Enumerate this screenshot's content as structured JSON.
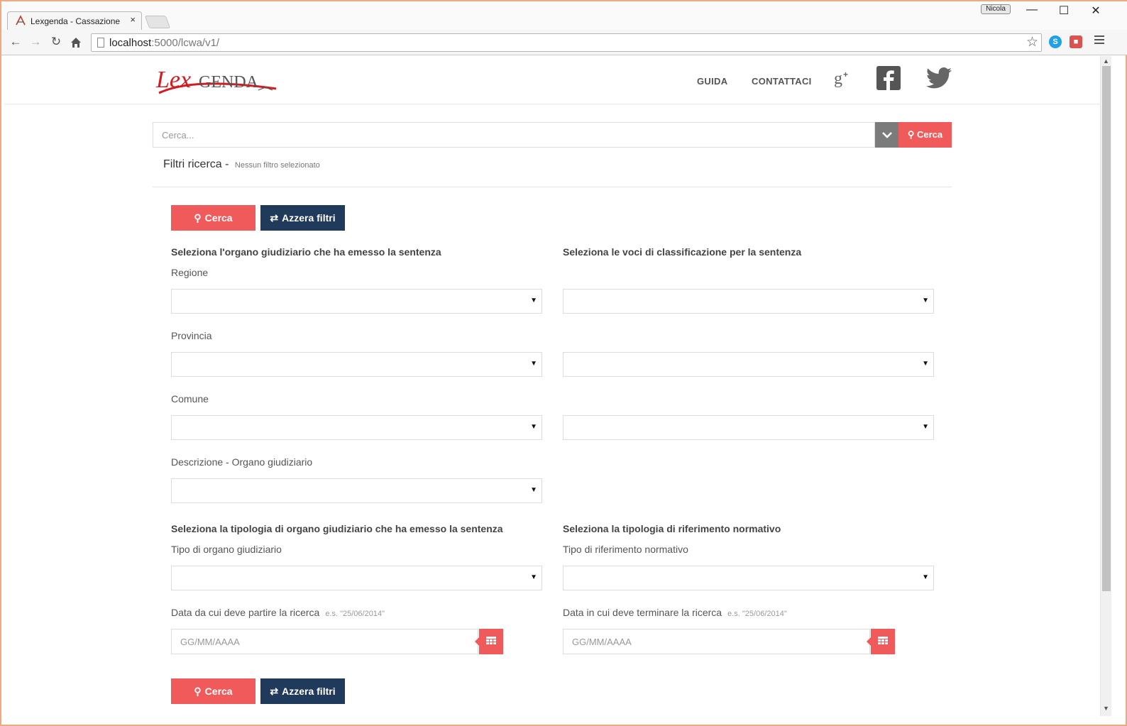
{
  "browser": {
    "tab_title": "Lexgenda - Cassazione",
    "tab_close": "×",
    "profile_name": "Nicola",
    "url_host": "localhost",
    "url_rest": ":5000/lcwa/v1/",
    "controls": {
      "minimize": "—",
      "maximize": "☐",
      "close": "✕"
    }
  },
  "header": {
    "logo_text": "LexGENDA",
    "nav": [
      {
        "label": "GUIDA"
      },
      {
        "label": "CONTATTACI"
      }
    ],
    "social": [
      "google-plus-icon",
      "facebook-icon",
      "twitter-icon"
    ]
  },
  "search": {
    "placeholder": "Cerca...",
    "button_label": "Cerca"
  },
  "filters": {
    "title": "Filtri ricerca",
    "separator": "-",
    "status": "Nessun filtro selezionato"
  },
  "actions": {
    "search_label": "Cerca",
    "reset_label": "Azzera filtri"
  },
  "organ_section": {
    "title": "Seleziona l'organo giudiziario che ha emesso la sentenza",
    "fields": [
      {
        "label": "Regione",
        "value": ""
      },
      {
        "label": "Provincia",
        "value": ""
      },
      {
        "label": "Comune",
        "value": ""
      },
      {
        "label": "Descrizione - Organo giudiziario",
        "value": ""
      }
    ]
  },
  "classification_section": {
    "title": "Seleziona le voci di classificazione per la sentenza",
    "fields": [
      {
        "value": ""
      },
      {
        "value": ""
      },
      {
        "value": ""
      }
    ]
  },
  "organ_type_section": {
    "title": "Seleziona la tipologia di organo giudiziario che ha emesso la sentenza",
    "label": "Tipo di organo giudiziario",
    "value": ""
  },
  "norm_type_section": {
    "title": "Seleziona la tipologia di riferimento normativo",
    "label": "Tipo di riferimento normativo",
    "value": ""
  },
  "date_from": {
    "label": "Data da cui deve partire la ricerca",
    "hint": "e.s. \"25/06/2014\"",
    "placeholder": "GG/MM/AAAA"
  },
  "date_to": {
    "label": "Data in cui deve terminare la ricerca",
    "hint": "e.s. \"25/06/2014\"",
    "placeholder": "GG/MM/AAAA"
  },
  "colors": {
    "accent_red": "#f05a5b",
    "navy": "#1f3a5a",
    "toggle_gray": "#7b7b7b"
  }
}
